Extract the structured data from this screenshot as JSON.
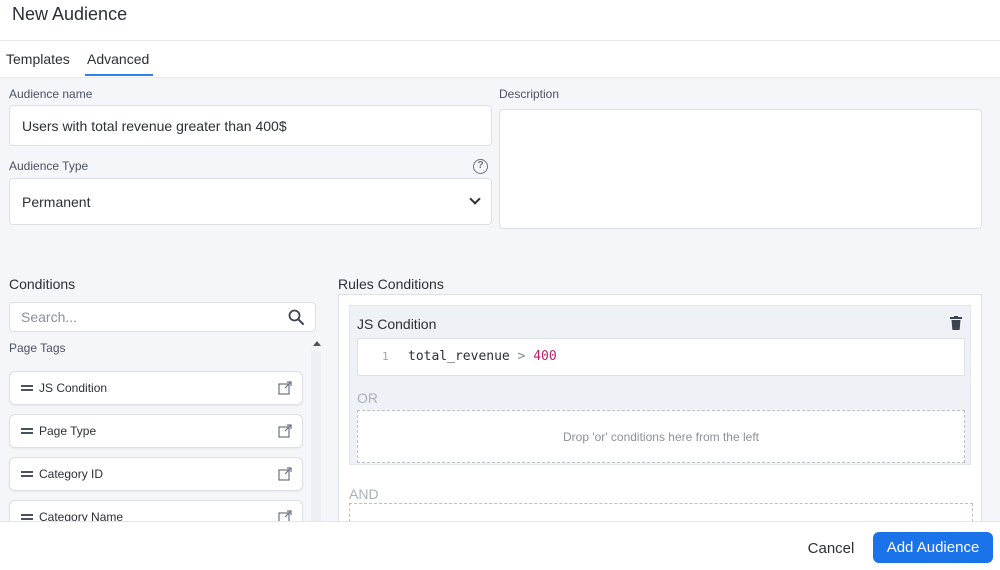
{
  "dialog": {
    "title": "New Audience"
  },
  "tabs": [
    {
      "label": "Templates",
      "active": false
    },
    {
      "label": "Advanced",
      "active": true
    }
  ],
  "form": {
    "audience_name_label": "Audience name",
    "audience_name_value": "Users with total revenue greater than 400$",
    "description_label": "Description",
    "description_value": "",
    "audience_type_label": "Audience Type",
    "audience_type_value": "Permanent",
    "help_icon": "?"
  },
  "conditions": {
    "title": "Conditions",
    "search_placeholder": "Search...",
    "group_label": "Page Tags",
    "items": [
      {
        "label": "JS Condition"
      },
      {
        "label": "Page Type"
      },
      {
        "label": "Category ID"
      },
      {
        "label": "Category Name"
      }
    ]
  },
  "rules": {
    "title": "Rules Conditions",
    "js_condition_title": "JS Condition",
    "code": {
      "line_number": "1",
      "variable": "total_revenue",
      "operator": ">",
      "value": "400"
    },
    "or_label": "OR",
    "or_drop_text": "Drop 'or' conditions here from the left",
    "and_label": "AND"
  },
  "footer": {
    "cancel_label": "Cancel",
    "add_label": "Add Audience"
  },
  "colors": {
    "accent": "#1a73e8",
    "tab_underline": "#2f80ed",
    "code_number": "#b5256b"
  },
  "icons": [
    "search-icon",
    "help-icon",
    "chevron-down-icon",
    "drag-handle-icon",
    "external-link-icon",
    "trash-icon",
    "scroll-up-icon"
  ]
}
